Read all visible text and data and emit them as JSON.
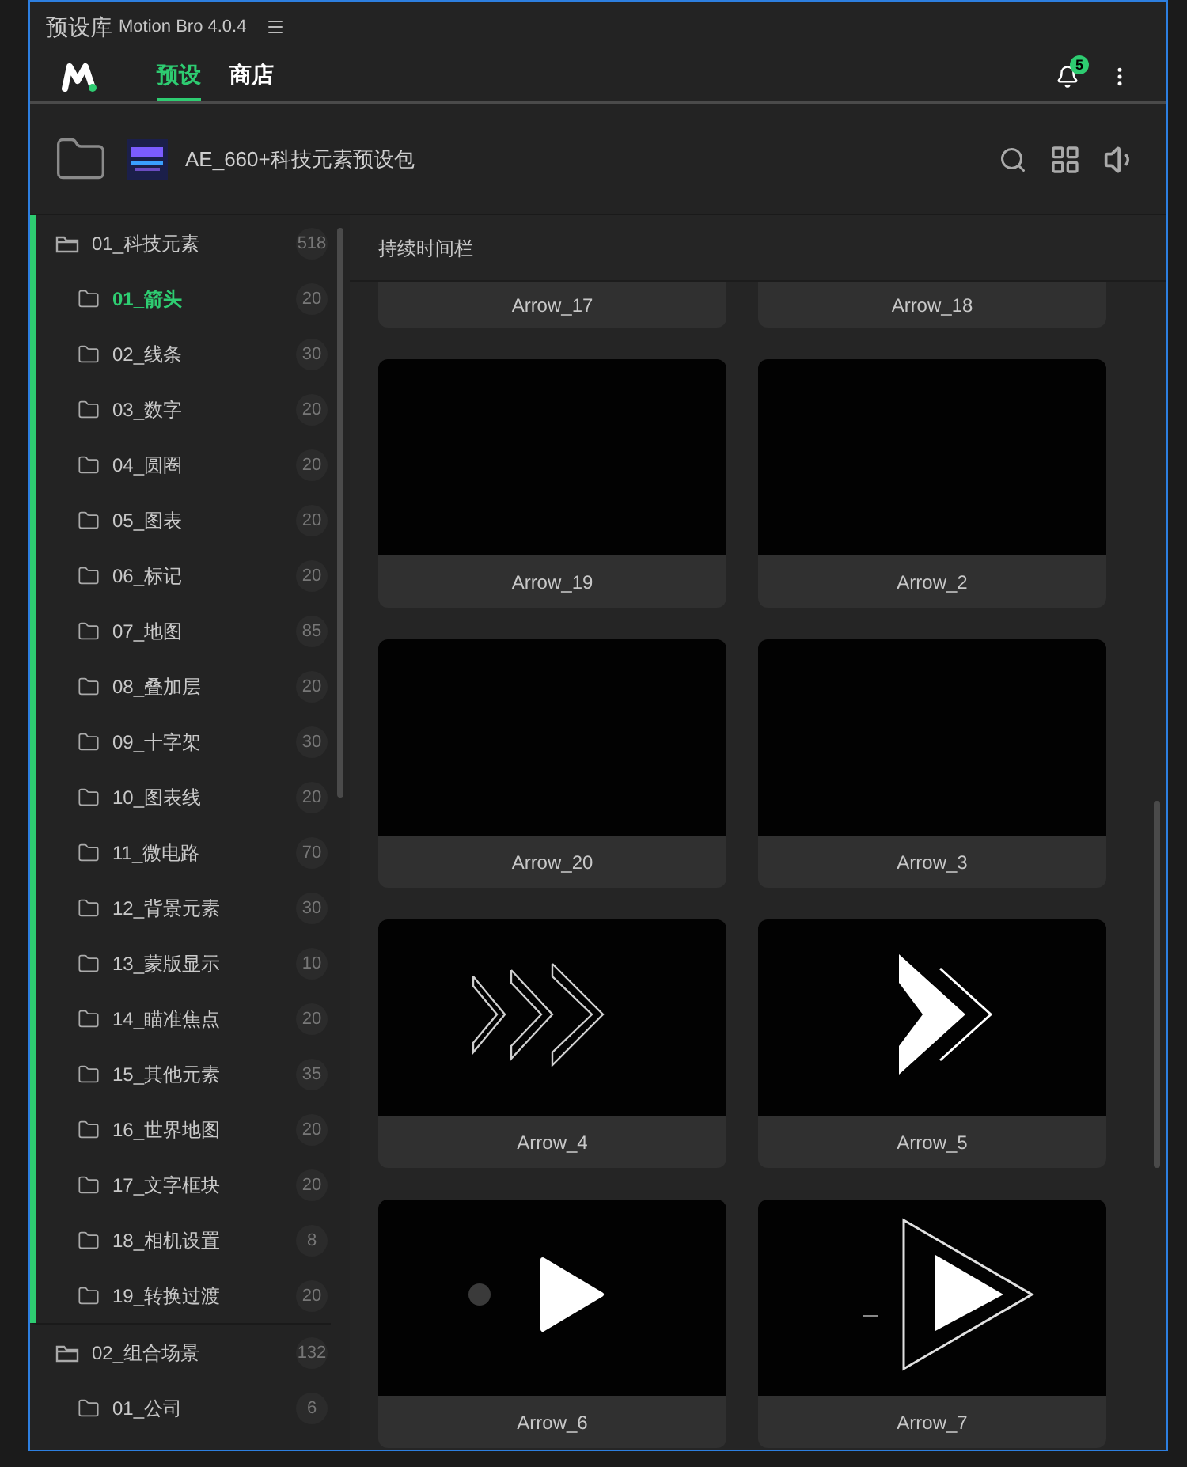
{
  "window": {
    "title": "预设库",
    "subtitle": "Motion Bro 4.0.4"
  },
  "nav": {
    "tabs": [
      {
        "label": "预设",
        "selected": true
      },
      {
        "label": "商店",
        "selected": false
      }
    ],
    "notifications": "5"
  },
  "pack": {
    "name": "AE_660+科技元素预设包"
  },
  "sidebar": {
    "groups": [
      {
        "label": "01_科技元素",
        "count": "518",
        "selected": true,
        "children": [
          {
            "label": "01_箭头",
            "count": "20",
            "selected": true
          },
          {
            "label": "02_线条",
            "count": "30",
            "selected": false
          },
          {
            "label": "03_数字",
            "count": "20",
            "selected": false
          },
          {
            "label": "04_圆圈",
            "count": "20",
            "selected": false
          },
          {
            "label": "05_图表",
            "count": "20",
            "selected": false
          },
          {
            "label": "06_标记",
            "count": "20",
            "selected": false
          },
          {
            "label": "07_地图",
            "count": "85",
            "selected": false
          },
          {
            "label": "08_叠加层",
            "count": "20",
            "selected": false
          },
          {
            "label": "09_十字架",
            "count": "30",
            "selected": false
          },
          {
            "label": "10_图表线",
            "count": "20",
            "selected": false
          },
          {
            "label": "11_微电路",
            "count": "70",
            "selected": false
          },
          {
            "label": "12_背景元素",
            "count": "30",
            "selected": false
          },
          {
            "label": "13_蒙版显示",
            "count": "10",
            "selected": false
          },
          {
            "label": "14_瞄准焦点",
            "count": "20",
            "selected": false
          },
          {
            "label": "15_其他元素",
            "count": "35",
            "selected": false
          },
          {
            "label": "16_世界地图",
            "count": "20",
            "selected": false
          },
          {
            "label": "17_文字框块",
            "count": "20",
            "selected": false
          },
          {
            "label": "18_相机设置",
            "count": "8",
            "selected": false
          },
          {
            "label": "19_转换过渡",
            "count": "20",
            "selected": false
          }
        ]
      },
      {
        "label": "02_组合场景",
        "count": "132",
        "selected": false,
        "children": [
          {
            "label": "01_公司",
            "count": "6",
            "selected": false
          }
        ]
      }
    ]
  },
  "content": {
    "section": "持续时间栏",
    "cards": [
      {
        "label": "Arrow_17",
        "kind": "label_only"
      },
      {
        "label": "Arrow_18",
        "kind": "label_only"
      },
      {
        "label": "Arrow_19",
        "kind": "preview"
      },
      {
        "label": "Arrow_2",
        "kind": "preview"
      },
      {
        "label": "Arrow_20",
        "kind": "preview"
      },
      {
        "label": "Arrow_3",
        "kind": "preview"
      },
      {
        "label": "Arrow_4",
        "kind": "preview"
      },
      {
        "label": "Arrow_5",
        "kind": "preview"
      },
      {
        "label": "Arrow_6",
        "kind": "preview"
      },
      {
        "label": "Arrow_7",
        "kind": "preview"
      }
    ]
  }
}
